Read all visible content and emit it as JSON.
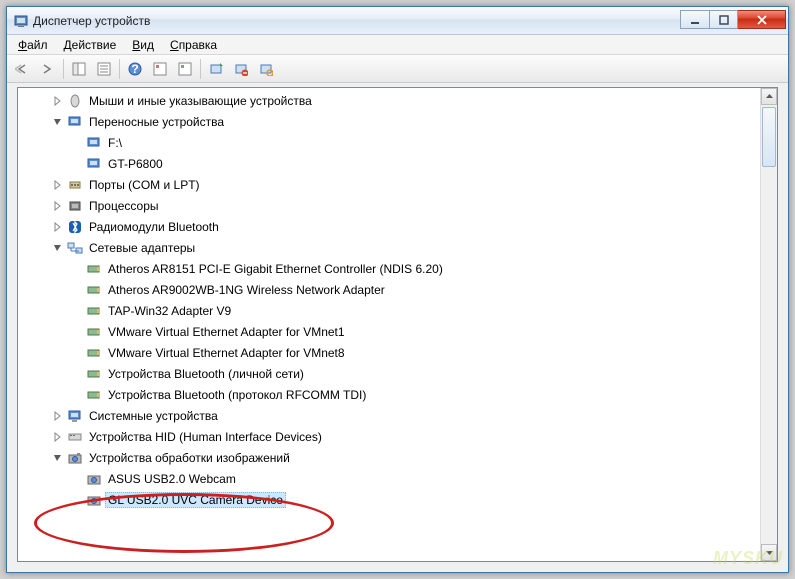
{
  "title": "Диспетчер устройств",
  "menu": {
    "file": "Файл",
    "action": "Действие",
    "view": "Вид",
    "help": "Справка"
  },
  "tree": {
    "mice": "Мыши и иные указывающие устройства",
    "portable": "Переносные устройства",
    "portable_f": "F:\\",
    "portable_gt": "GT-P6800",
    "ports": "Порты (COM и LPT)",
    "cpu": "Процессоры",
    "bt": "Радиомодули Bluetooth",
    "net": "Сетевые адаптеры",
    "net_ath1": "Atheros AR8151 PCI-E Gigabit Ethernet Controller (NDIS 6.20)",
    "net_ath2": "Atheros AR9002WB-1NG Wireless Network Adapter",
    "net_tap": "TAP-Win32 Adapter V9",
    "net_vm1": "VMware Virtual Ethernet Adapter for VMnet1",
    "net_vm8": "VMware Virtual Ethernet Adapter for VMnet8",
    "net_bt1": "Устройства Bluetooth (личной сети)",
    "net_bt2": "Устройства Bluetooth (протокол RFCOMM TDI)",
    "sys": "Системные устройства",
    "hid": "Устройства HID (Human Interface Devices)",
    "img": "Устройства обработки изображений",
    "img_asus": "ASUS USB2.0 Webcam",
    "img_gl": "GL USB2.0 UVC Camera Device"
  },
  "watermark": "MYSKU"
}
